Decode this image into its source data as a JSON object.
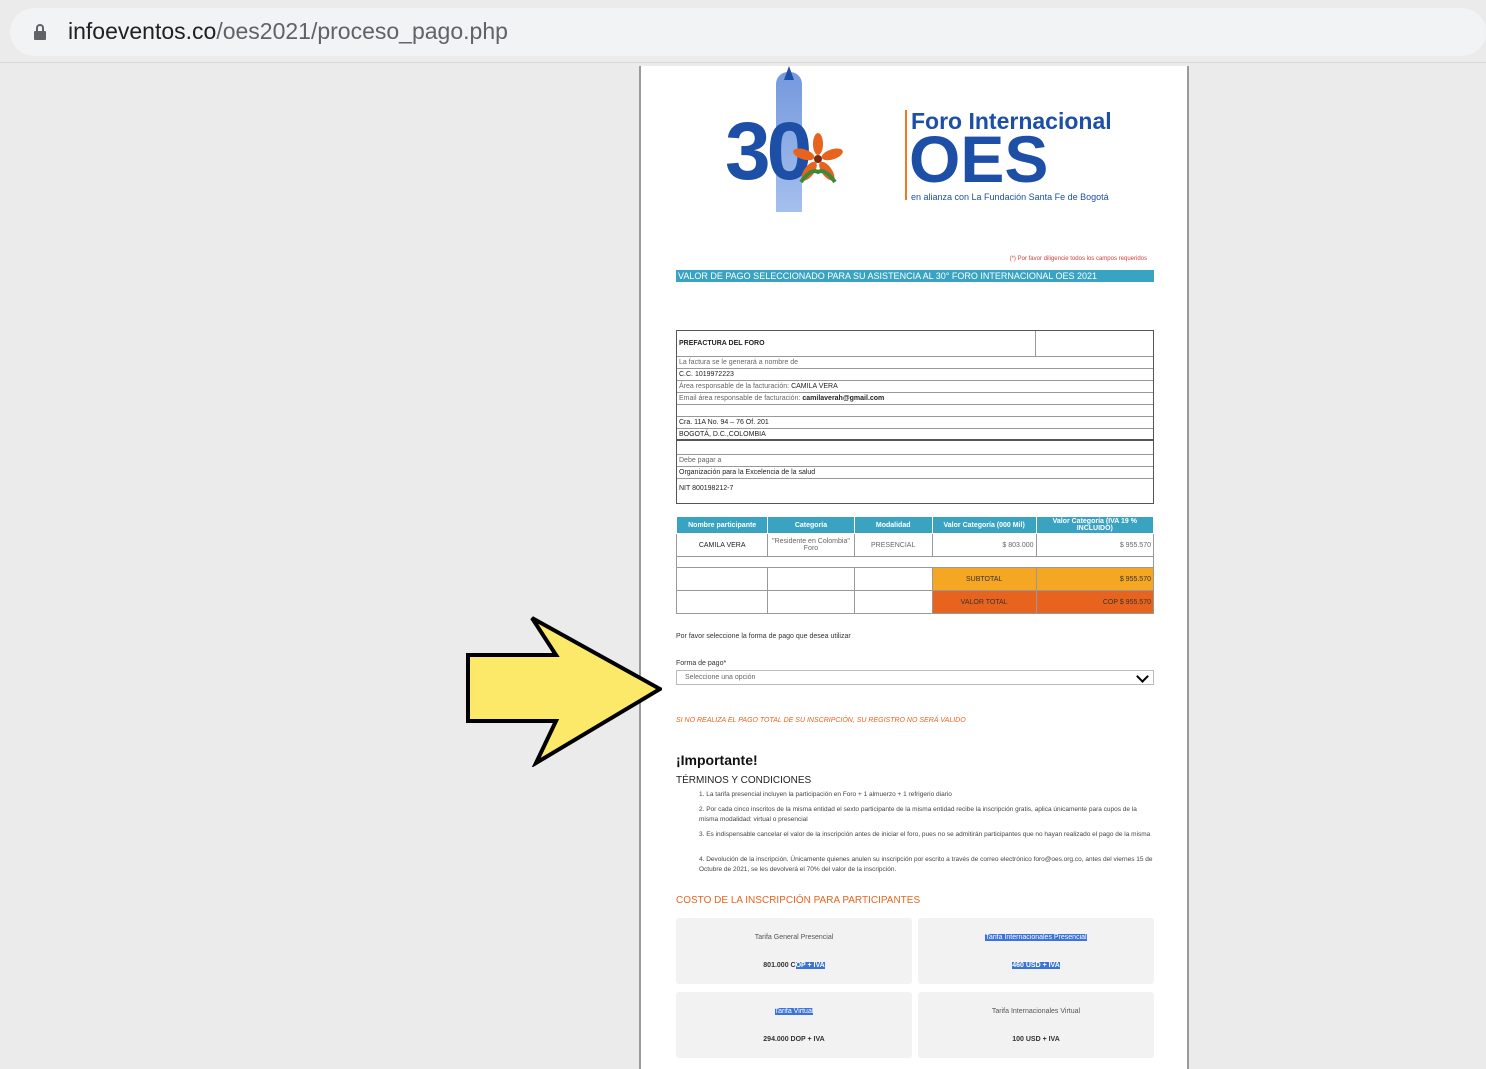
{
  "browser": {
    "url_host": "infoeventos.co",
    "url_path": "/oes2021/proceso_pago.php"
  },
  "logo": {
    "number": "30",
    "title": "Foro Internacional",
    "name": "OES",
    "subtitle": "en alianza con La Fundación Santa Fe de Bogotá"
  },
  "required_note": "(*) Por favor diligencie todos los campos requeridos",
  "section_title": "VALOR DE PAGO SELECCIONADO PARA SU ASISTENCIA AL 30° FORO INTERNACIONAL OES 2021",
  "prefactura": {
    "title": "PREFACTURA DEL FORO",
    "invoice_to_label": "La factura se le generará a nombre de",
    "cc": "C.C. 1019972223",
    "resp_label": "Área responsable de la facturación:",
    "resp_value": "CAMILA VERA",
    "email_label": "Email área responsable de facturación:",
    "email_value": "camilaverah@gmail.com",
    "address": "Cra. 11A No. 94 – 76 Of. 201",
    "city": "BOGOTÁ, D.C.,COLOMBIA",
    "pay_to_label": "Debe pagar a",
    "org": "Organización para la Excelencia de la salud",
    "nit": "NIT 800198212-7"
  },
  "table": {
    "headers": [
      "Nombre participante",
      "Categoría",
      "Modalidad",
      "Valor Categoría (000 Mil)",
      "Valor Categoría (IVA 19 % INCLUIDO)"
    ],
    "row": [
      "CAMILA VERA",
      "\"Residente en Colombia\" Foro",
      "PRESENCIAL",
      "$ 803.000",
      "$ 955.570"
    ],
    "subtotal_label": "SUBTOTAL",
    "subtotal_value": "$ 955.570",
    "total_label": "VALOR TOTAL",
    "total_value": "COP $ 955.570"
  },
  "payment": {
    "prompt": "Por favor seleccione la forma de pago que desea utilizar",
    "label": "Forma de pago*",
    "placeholder": "Seleccione una opción"
  },
  "warning": "SI NO REALIZA EL PAGO TOTAL DE SU INSCRIPCIÓN, SU REGISTRO NO SERÁ VALIDO",
  "important": "¡Importante!",
  "terms_title": "TÉRMINOS Y CONDICIONES",
  "terms": [
    "1. La tarifa presencial incluyen la participación en Foro + 1 almuerzo + 1 refrigerio diario",
    "2. Por cada cinco inscritos de la misma entidad el sexto participante de la misma entidad recibe la inscripción gratis, aplica únicamente para cupos de la misma modalidad: virtual o presencial",
    "3. Es indispensable cancelar el valor de la inscripción antes de iniciar el foro, pues no se admitirán participantes que no hayan realizado el pago de la misma",
    "4. Devolución de la inscripción. Únicamente quienes anulen su inscripción por escrito a través de correo electrónico foro@oes.org.co, antes del viernes 15 de Octubre de 2021, se les devolverá el 70% del valor de la inscripción."
  ],
  "costo_title": "COSTO DE LA INSCRIPCIÓN PARA PARTICIPANTES",
  "prices": [
    {
      "title": "Tarifa General Presencial",
      "price_a": "801.000 C",
      "price_b": "OP + IVA"
    },
    {
      "title": "Tarifa Internacionales Presencial",
      "price_a": "",
      "price_b": "460 USD + IVA"
    },
    {
      "title": "Tarifa Virtual",
      "price_a": "294.000 DOP + IVA",
      "price_b": ""
    },
    {
      "title": "Tarifa Internacionales Virtual",
      "price_a": "100 USD + IVA",
      "price_b": ""
    }
  ],
  "colors": {
    "brand_blue": "#1d4fa7",
    "accent_teal": "#3aa3c2",
    "subtotal": "#f5a623",
    "total": "#e8641e",
    "arrow": "#fce96a"
  }
}
